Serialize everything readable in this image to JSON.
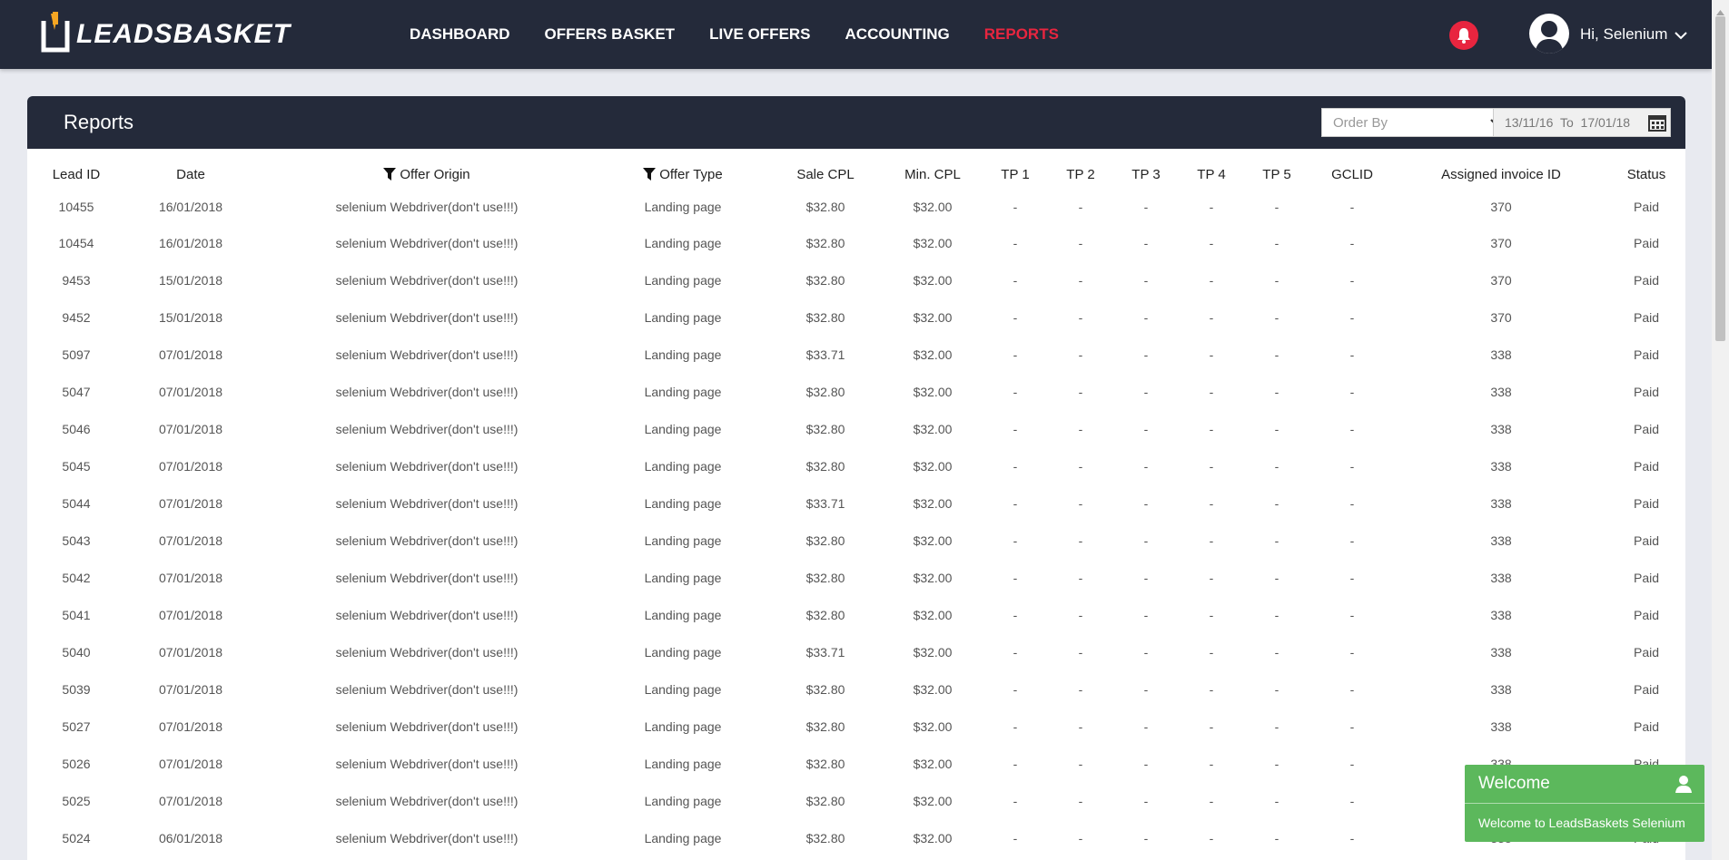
{
  "brand": {
    "name": "LEADSBASKET"
  },
  "nav": {
    "items": [
      {
        "label": "DASHBOARD"
      },
      {
        "label": "OFFERS BASKET"
      },
      {
        "label": "LIVE OFFERS"
      },
      {
        "label": "ACCOUNTING"
      },
      {
        "label": "REPORTS",
        "active": true
      }
    ]
  },
  "user": {
    "greeting": "Hi, Selenium"
  },
  "colors": {
    "navbar": "#242a3a",
    "accent": "#e8253f",
    "toast": "#5cb85c"
  },
  "reports": {
    "title": "Reports",
    "order_by_placeholder": "Order By",
    "date_range": "13/11/16  To  17/01/18",
    "columns": [
      "Lead ID",
      "Date",
      "Offer Origin",
      "Offer Type",
      "Sale CPL",
      "Min. CPL",
      "TP 1",
      "TP 2",
      "TP 3",
      "TP 4",
      "TP 5",
      "GCLID",
      "Assigned invoice ID",
      "Status"
    ],
    "rows": [
      [
        "10455",
        "16/01/2018",
        "selenium Webdriver(don't use!!!)",
        "Landing page",
        "$32.80",
        "$32.00",
        "-",
        "-",
        "-",
        "-",
        "-",
        "-",
        "370",
        "Paid"
      ],
      [
        "10454",
        "16/01/2018",
        "selenium Webdriver(don't use!!!)",
        "Landing page",
        "$32.80",
        "$32.00",
        "-",
        "-",
        "-",
        "-",
        "-",
        "-",
        "370",
        "Paid"
      ],
      [
        "9453",
        "15/01/2018",
        "selenium Webdriver(don't use!!!)",
        "Landing page",
        "$32.80",
        "$32.00",
        "-",
        "-",
        "-",
        "-",
        "-",
        "-",
        "370",
        "Paid"
      ],
      [
        "9452",
        "15/01/2018",
        "selenium Webdriver(don't use!!!)",
        "Landing page",
        "$32.80",
        "$32.00",
        "-",
        "-",
        "-",
        "-",
        "-",
        "-",
        "370",
        "Paid"
      ],
      [
        "5097",
        "07/01/2018",
        "selenium Webdriver(don't use!!!)",
        "Landing page",
        "$33.71",
        "$32.00",
        "-",
        "-",
        "-",
        "-",
        "-",
        "-",
        "338",
        "Paid"
      ],
      [
        "5047",
        "07/01/2018",
        "selenium Webdriver(don't use!!!)",
        "Landing page",
        "$32.80",
        "$32.00",
        "-",
        "-",
        "-",
        "-",
        "-",
        "-",
        "338",
        "Paid"
      ],
      [
        "5046",
        "07/01/2018",
        "selenium Webdriver(don't use!!!)",
        "Landing page",
        "$32.80",
        "$32.00",
        "-",
        "-",
        "-",
        "-",
        "-",
        "-",
        "338",
        "Paid"
      ],
      [
        "5045",
        "07/01/2018",
        "selenium Webdriver(don't use!!!)",
        "Landing page",
        "$32.80",
        "$32.00",
        "-",
        "-",
        "-",
        "-",
        "-",
        "-",
        "338",
        "Paid"
      ],
      [
        "5044",
        "07/01/2018",
        "selenium Webdriver(don't use!!!)",
        "Landing page",
        "$33.71",
        "$32.00",
        "-",
        "-",
        "-",
        "-",
        "-",
        "-",
        "338",
        "Paid"
      ],
      [
        "5043",
        "07/01/2018",
        "selenium Webdriver(don't use!!!)",
        "Landing page",
        "$32.80",
        "$32.00",
        "-",
        "-",
        "-",
        "-",
        "-",
        "-",
        "338",
        "Paid"
      ],
      [
        "5042",
        "07/01/2018",
        "selenium Webdriver(don't use!!!)",
        "Landing page",
        "$32.80",
        "$32.00",
        "-",
        "-",
        "-",
        "-",
        "-",
        "-",
        "338",
        "Paid"
      ],
      [
        "5041",
        "07/01/2018",
        "selenium Webdriver(don't use!!!)",
        "Landing page",
        "$32.80",
        "$32.00",
        "-",
        "-",
        "-",
        "-",
        "-",
        "-",
        "338",
        "Paid"
      ],
      [
        "5040",
        "07/01/2018",
        "selenium Webdriver(don't use!!!)",
        "Landing page",
        "$33.71",
        "$32.00",
        "-",
        "-",
        "-",
        "-",
        "-",
        "-",
        "338",
        "Paid"
      ],
      [
        "5039",
        "07/01/2018",
        "selenium Webdriver(don't use!!!)",
        "Landing page",
        "$32.80",
        "$32.00",
        "-",
        "-",
        "-",
        "-",
        "-",
        "-",
        "338",
        "Paid"
      ],
      [
        "5027",
        "07/01/2018",
        "selenium Webdriver(don't use!!!)",
        "Landing page",
        "$32.80",
        "$32.00",
        "-",
        "-",
        "-",
        "-",
        "-",
        "-",
        "338",
        "Paid"
      ],
      [
        "5026",
        "07/01/2018",
        "selenium Webdriver(don't use!!!)",
        "Landing page",
        "$32.80",
        "$32.00",
        "-",
        "-",
        "-",
        "-",
        "-",
        "-",
        "338",
        "Paid"
      ],
      [
        "5025",
        "07/01/2018",
        "selenium Webdriver(don't use!!!)",
        "Landing page",
        "$32.80",
        "$32.00",
        "-",
        "-",
        "-",
        "-",
        "-",
        "-",
        "338",
        "Paid"
      ],
      [
        "5024",
        "06/01/2018",
        "selenium Webdriver(don't use!!!)",
        "Landing page",
        "$32.80",
        "$32.00",
        "-",
        "-",
        "-",
        "-",
        "-",
        "-",
        "338",
        "Paid"
      ]
    ]
  },
  "toast": {
    "title": "Welcome",
    "message": "Welcome to LeadsBaskets Selenium"
  }
}
